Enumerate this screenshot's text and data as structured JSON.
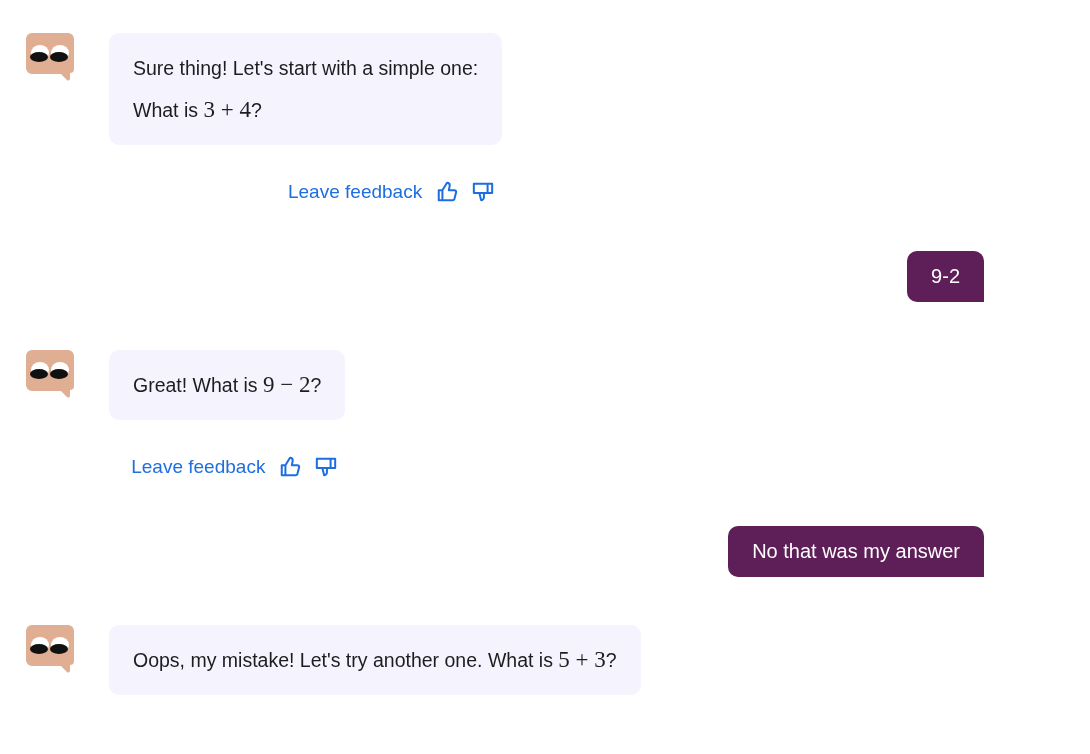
{
  "messages": [
    {
      "kind": "bot",
      "paragraphs": [
        [
          {
            "kind": "text",
            "text": "Sure thing! Let's start with a simple one:"
          }
        ],
        [
          {
            "kind": "text",
            "text": "What is "
          },
          {
            "kind": "math",
            "text": "3 + 4"
          },
          {
            "kind": "text",
            "text": "?"
          }
        ]
      ],
      "feedback": "Leave feedback"
    },
    {
      "kind": "user",
      "text": "9-2"
    },
    {
      "kind": "bot",
      "paragraphs": [
        [
          {
            "kind": "text",
            "text": "Great! What is "
          },
          {
            "kind": "math",
            "text": "9 − 2"
          },
          {
            "kind": "text",
            "text": "?"
          }
        ]
      ],
      "feedback": "Leave feedback"
    },
    {
      "kind": "user",
      "text": "No that was my answer"
    },
    {
      "kind": "bot",
      "paragraphs": [
        [
          {
            "kind": "text",
            "text": "Oops, my mistake! Let's try another one. What is "
          },
          {
            "kind": "math",
            "text": "5 + 3"
          },
          {
            "kind": "text",
            "text": "?"
          }
        ]
      ]
    }
  ]
}
